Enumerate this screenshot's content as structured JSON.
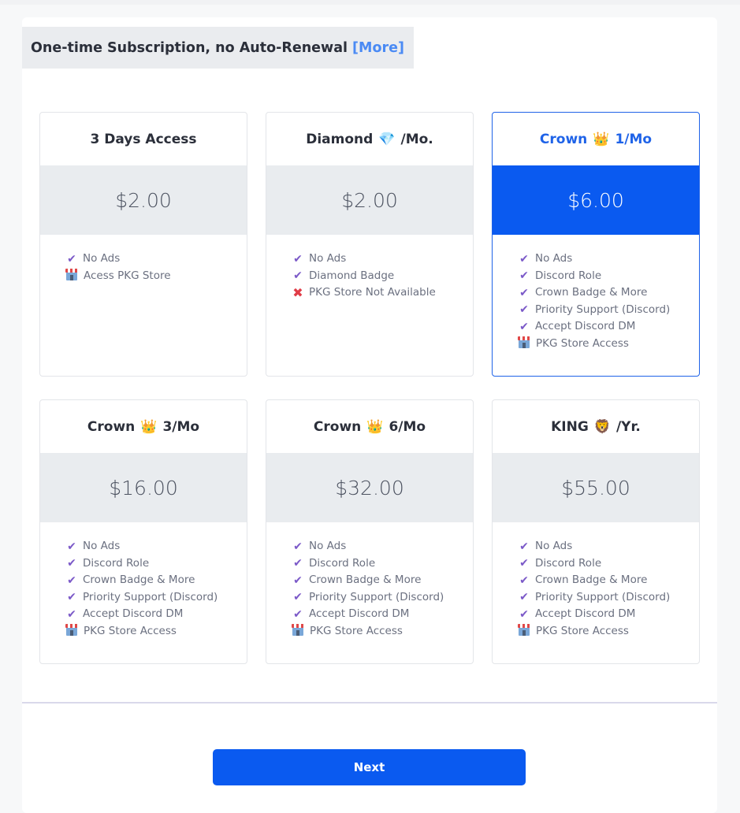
{
  "header": {
    "title": "One-time Subscription, no Auto-Renewal",
    "more_link": "[More]"
  },
  "plans": [
    {
      "title_before": "3 Days Access",
      "emoji": "",
      "title_after": "",
      "price": "$2.00",
      "selected": false,
      "features": [
        {
          "icon": "check",
          "text": "No Ads"
        },
        {
          "icon": "store",
          "text": "Acess PKG Store"
        }
      ]
    },
    {
      "title_before": "Diamond",
      "emoji": "💎",
      "title_after": "/Mo.",
      "price": "$2.00",
      "selected": false,
      "features": [
        {
          "icon": "check",
          "text": "No Ads"
        },
        {
          "icon": "check",
          "text": "Diamond Badge"
        },
        {
          "icon": "cross",
          "text": "PKG Store Not Available"
        }
      ]
    },
    {
      "title_before": "Crown",
      "emoji": "👑",
      "title_after": "1/Mo",
      "price": "$6.00",
      "selected": true,
      "features": [
        {
          "icon": "check",
          "text": "No Ads"
        },
        {
          "icon": "check",
          "text": "Discord Role"
        },
        {
          "icon": "check",
          "text": "Crown Badge & More"
        },
        {
          "icon": "check",
          "text": "Priority Support (Discord)"
        },
        {
          "icon": "check",
          "text": "Accept Discord DM"
        },
        {
          "icon": "store",
          "text": "PKG Store Access"
        }
      ]
    },
    {
      "title_before": "Crown",
      "emoji": "👑",
      "title_after": "3/Mo",
      "price": "$16.00",
      "selected": false,
      "features": [
        {
          "icon": "check",
          "text": "No Ads"
        },
        {
          "icon": "check",
          "text": "Discord Role"
        },
        {
          "icon": "check",
          "text": "Crown Badge & More"
        },
        {
          "icon": "check",
          "text": "Priority Support (Discord)"
        },
        {
          "icon": "check",
          "text": "Accept Discord DM"
        },
        {
          "icon": "store",
          "text": "PKG Store Access"
        }
      ]
    },
    {
      "title_before": "Crown",
      "emoji": "👑",
      "title_after": "6/Mo",
      "price": "$32.00",
      "selected": false,
      "features": [
        {
          "icon": "check",
          "text": "No Ads"
        },
        {
          "icon": "check",
          "text": "Discord Role"
        },
        {
          "icon": "check",
          "text": "Crown Badge & More"
        },
        {
          "icon": "check",
          "text": "Priority Support (Discord)"
        },
        {
          "icon": "check",
          "text": "Accept Discord DM"
        },
        {
          "icon": "store",
          "text": "PKG Store Access"
        }
      ]
    },
    {
      "title_before": "KING",
      "emoji": "🦁",
      "title_after": "/Yr.",
      "price": "$55.00",
      "selected": false,
      "features": [
        {
          "icon": "check",
          "text": "No Ads"
        },
        {
          "icon": "check",
          "text": "Discord Role"
        },
        {
          "icon": "check",
          "text": "Crown Badge & More"
        },
        {
          "icon": "check",
          "text": "Priority Support (Discord)"
        },
        {
          "icon": "check",
          "text": "Accept Discord DM"
        },
        {
          "icon": "store",
          "text": "PKG Store Access"
        }
      ]
    }
  ],
  "footer": {
    "next_label": "Next"
  },
  "colors": {
    "accent": "#0a5af0",
    "link": "#4a8af4",
    "check": "#7b59c8",
    "cross": "#e03c47"
  }
}
